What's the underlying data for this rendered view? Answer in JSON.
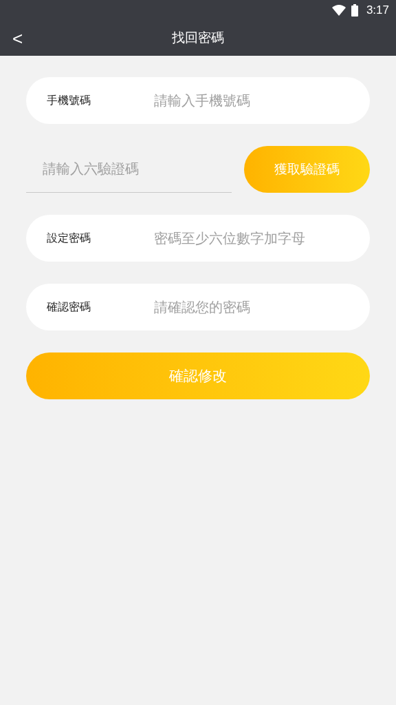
{
  "status_bar": {
    "time": "3:17"
  },
  "header": {
    "back": "<",
    "title": "找回密碼"
  },
  "phone": {
    "label": "手機號碼",
    "placeholder": "請輸入手機號碼"
  },
  "code": {
    "placeholder": "請輸入六驗證碼",
    "button": "獲取驗證碼"
  },
  "password": {
    "label": "設定密碼",
    "placeholder": "密碼至少六位數字加字母"
  },
  "confirm": {
    "label": "確認密碼",
    "placeholder": "請確認您的密碼"
  },
  "submit": "確認修改"
}
